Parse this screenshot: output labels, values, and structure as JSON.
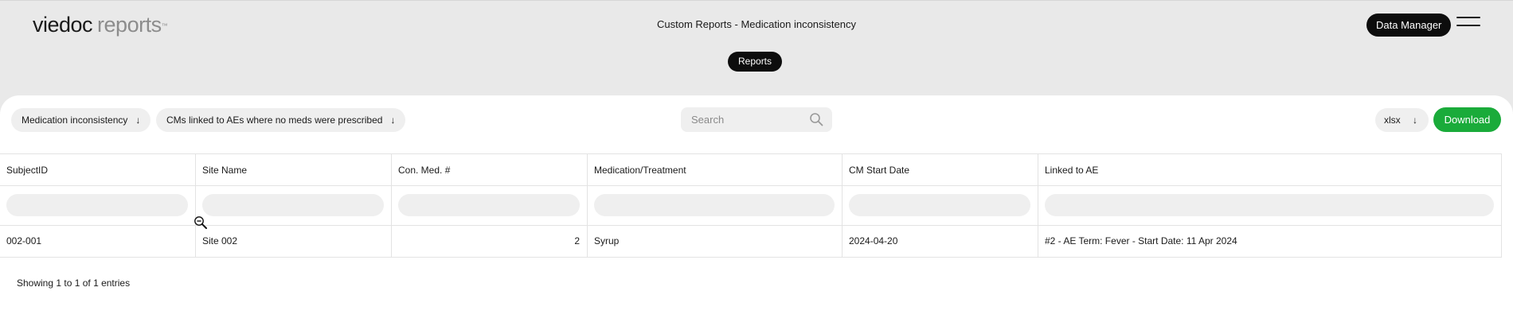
{
  "header": {
    "logo_brand": "viedoc",
    "logo_product": "reports",
    "logo_tm": "™",
    "page_title": "Custom Reports - Medication inconsistency",
    "role_button": "Data Manager",
    "menu_icon": "hamburger-menu-icon",
    "reports_pill": "Reports"
  },
  "toolbar": {
    "report_select": "Medication inconsistency",
    "subreport_select": "CMs linked to AEs where no meds were prescribed",
    "dropdown_arrow": "↓",
    "search_placeholder": "Search",
    "search_icon": "search-icon",
    "format_select": "xlsx",
    "download_label": "Download",
    "download_color": "#1aab3a"
  },
  "table": {
    "columns": [
      "SubjectID",
      "Site Name",
      "Con. Med. #",
      "Medication/Treatment",
      "CM Start Date",
      "Linked to AE"
    ],
    "rows": [
      [
        "002-001",
        "Site 002",
        "2",
        "Syrup",
        "2024-04-20",
        "#2 - AE Term: Fever - Start Date: 11 Apr 2024"
      ]
    ]
  },
  "footer": {
    "entries_text": "Showing 1 to 1 of 1 entries"
  },
  "cursor": "zoom-out-cursor-icon"
}
